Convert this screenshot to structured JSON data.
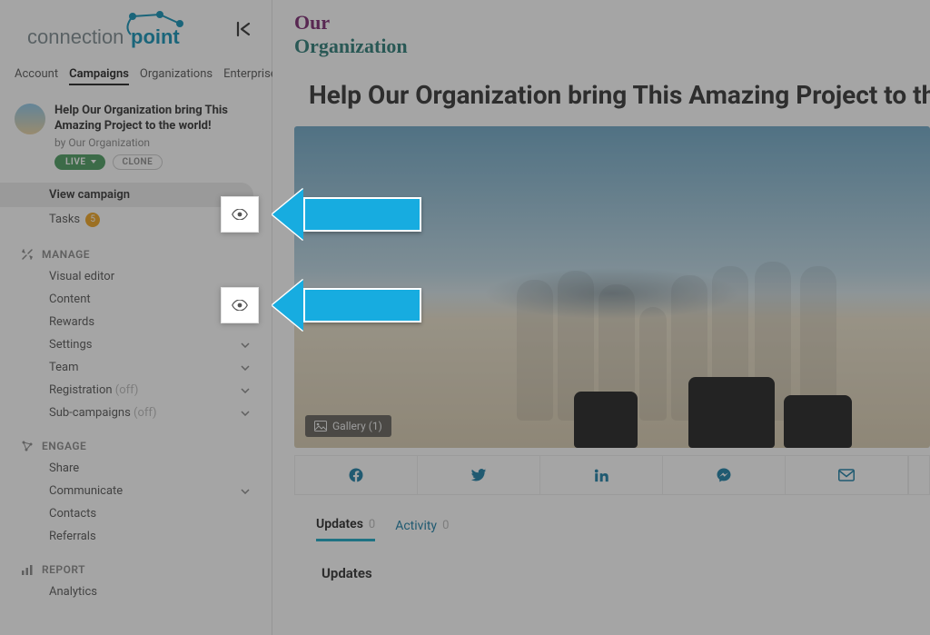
{
  "logo_text": "connectionpoint",
  "tabs": {
    "account": "Account",
    "campaigns": "Campaigns",
    "organizations": "Organizations",
    "enterprise": "Enterprise"
  },
  "campaign": {
    "title": "Help Our Organization bring This Amazing Project to the world!",
    "by_prefix": "by ",
    "org": "Our Organization",
    "live_label": "LIVE",
    "clone_label": "CLONE"
  },
  "nav": {
    "view_campaign": "View campaign",
    "tasks": "Tasks",
    "tasks_count": "5"
  },
  "sections": {
    "manage": {
      "header": "MANAGE",
      "visual_editor": "Visual editor",
      "content": "Content",
      "rewards": "Rewards",
      "settings": "Settings",
      "team": "Team",
      "registration": "Registration",
      "registration_state": "(off)",
      "sub_campaigns": "Sub-campaigns",
      "sub_campaigns_state": "(off)"
    },
    "engage": {
      "header": "ENGAGE",
      "share": "Share",
      "communicate": "Communicate",
      "contacts": "Contacts",
      "referrals": "Referrals"
    },
    "report": {
      "header": "REPORT",
      "analytics": "Analytics"
    }
  },
  "org_header": {
    "line1": "Our",
    "line2": "Organization"
  },
  "page": {
    "title": "Help Our Organization bring This Amazing Project to the world!",
    "gallery_label": "Gallery (1)"
  },
  "page_tabs": {
    "updates": "Updates",
    "updates_count": "0",
    "activity": "Activity",
    "activity_count": "0"
  },
  "updates_heading": "Updates"
}
